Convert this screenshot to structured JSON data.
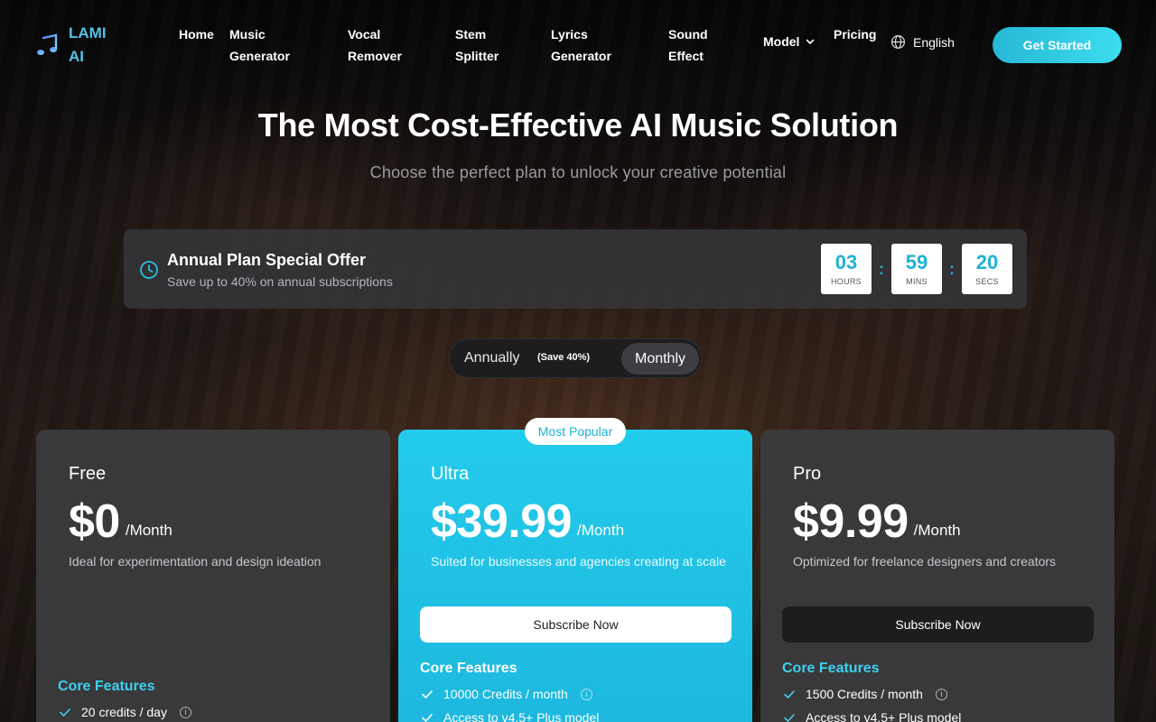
{
  "brand": {
    "name_line1": "LAMI",
    "name_line2": "AI",
    "icon": "music-note-icon"
  },
  "nav": {
    "home": "Home",
    "music_generator": "Music Generator",
    "vocal_remover": "Vocal Remover",
    "stem_splitter": "Stem Splitter",
    "lyrics_generator": "Lyrics Generator",
    "sound_effect": "Sound Effect",
    "model": "Model",
    "pricing": "Pricing",
    "language": "English",
    "cta": "Get Started"
  },
  "hero": {
    "title": "The Most Cost-Effective AI Music Solution",
    "subtitle": "Choose the perfect plan to unlock your creative potential"
  },
  "offer": {
    "title": "Annual Plan Special Offer",
    "subtitle": "Save up to 40% on annual subscriptions",
    "timer": {
      "hours": "03",
      "hours_label": "HOURS",
      "mins": "59",
      "mins_label": "MINS",
      "secs": "20",
      "secs_label": "SECS",
      "separator": ":"
    }
  },
  "billing_toggle": {
    "annually": "Annually",
    "save": "(Save 40%)",
    "monthly": "Monthly",
    "selected": "Monthly"
  },
  "plans": {
    "free": {
      "name": "Free",
      "price": "$0",
      "period": "/Month",
      "description": "Ideal for experimentation and design ideation",
      "features_title": "Core Features",
      "features": [
        "20 credits / day"
      ]
    },
    "ultra": {
      "badge": "Most Popular",
      "name": "Ultra",
      "price": "$39.99",
      "period": "/Month",
      "description": "Suited for businesses and agencies creating at scale",
      "button": "Subscribe Now",
      "features_title": "Core Features",
      "features": [
        "10000 Credits / month",
        "Access to v4.5+ Plus model"
      ]
    },
    "pro": {
      "name": "Pro",
      "price": "$9.99",
      "period": "/Month",
      "description": "Optimized for freelance designers and creators",
      "button": "Subscribe Now",
      "features_title": "Core Features",
      "features": [
        "1500 Credits / month",
        "Access to v4.5+ Plus model"
      ]
    }
  },
  "colors": {
    "accent": "#26b8d6",
    "ultra_card": "#22cbeb",
    "card_dark": "#3a3a3c"
  }
}
